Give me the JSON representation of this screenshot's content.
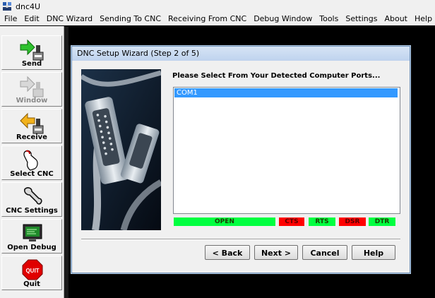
{
  "window": {
    "title": "dnc4U"
  },
  "menu": [
    "File",
    "Edit",
    "DNC Wizard",
    "Sending To CNC",
    "Receiving From CNC",
    "Debug Window",
    "Tools",
    "Settings",
    "About",
    "Help"
  ],
  "toolbar": {
    "send": "Send",
    "window": "Window",
    "receive": "Receive",
    "select_cnc": "Select CNC",
    "cnc_settings": "CNC Settings",
    "open_debug": "Open Debug",
    "quit": "Quit",
    "quit_icon_text": "QUIT"
  },
  "dialog": {
    "title": "DNC Setup Wizard (Step 2 of 5)",
    "prompt": "Please Select From Your Detected Computer Ports...",
    "ports": [
      "COM1"
    ],
    "selected_port": "COM1",
    "signals": {
      "open": {
        "label": "OPEN",
        "color": "#00ff40"
      },
      "cts": {
        "label": "CTS",
        "color": "#ff0000"
      },
      "rts": {
        "label": "RTS",
        "color": "#00ff40"
      },
      "dsr": {
        "label": "DSR",
        "color": "#ff0000"
      },
      "dtr": {
        "label": "DTR",
        "color": "#00ff40"
      }
    },
    "buttons": {
      "back": "< Back",
      "next": "Next >",
      "cancel": "Cancel",
      "help": "Help"
    }
  },
  "icons": {
    "app": "dnc4u-app-icon",
    "send": "green-right-arrow-machine-icon",
    "window": "gray-right-arrow-machine-icon",
    "receive": "yellow-left-arrow-machine-icon",
    "select_cnc": "hand-pointer-icon",
    "cnc_settings": "wrench-icon",
    "open_debug": "monitor-icon",
    "quit": "stop-sign-icon"
  }
}
